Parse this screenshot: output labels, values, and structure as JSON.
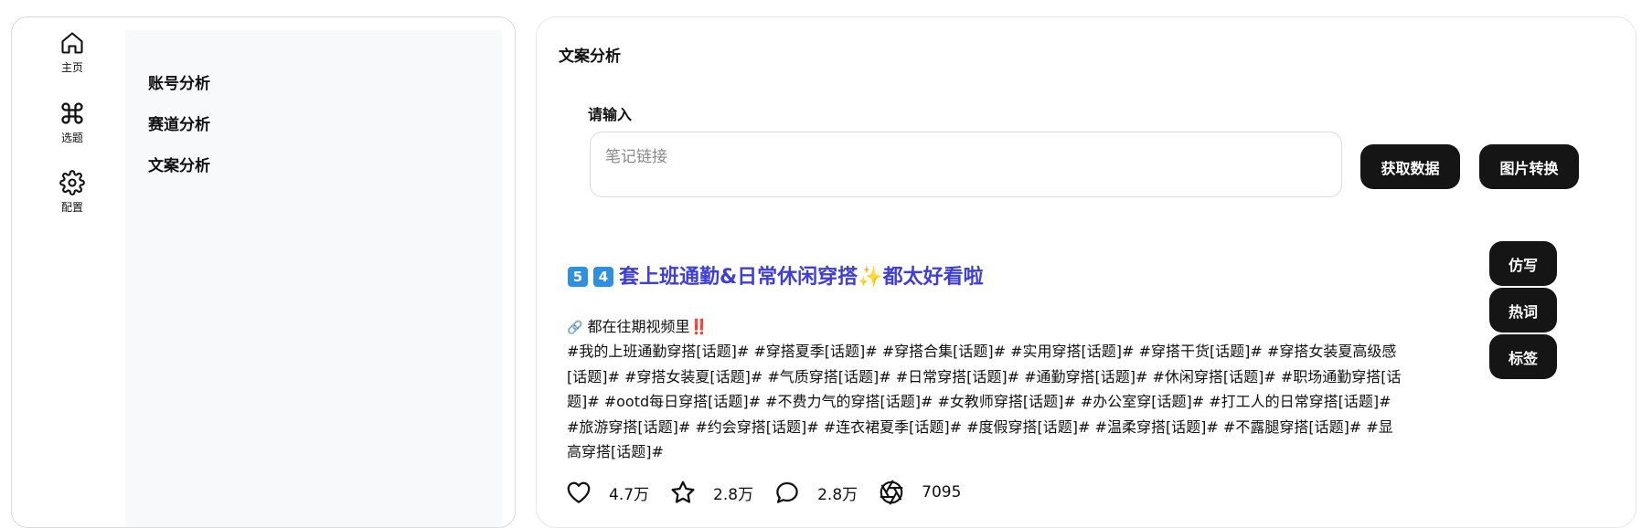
{
  "sidebar": {
    "rail": [
      {
        "label": "主页",
        "icon": "home-icon"
      },
      {
        "label": "选题",
        "icon": "command-icon"
      },
      {
        "label": "配置",
        "icon": "gear-icon"
      }
    ],
    "submenu": [
      "账号分析",
      "赛道分析",
      "文案分析"
    ]
  },
  "main": {
    "title": "文案分析",
    "input_label": "请输入",
    "input_placeholder": "笔记链接",
    "input_value": "",
    "fetch_button": "获取数据",
    "convert_button": "图片转换"
  },
  "note": {
    "num1": "5",
    "num2": "4",
    "title": "套上班通勤&日常休闲穿搭",
    "sparkle": "✨",
    "title_end": "都太好看啦",
    "link_icon": "🔗",
    "line1": "都在往期视频里",
    "bang": "‼️",
    "body": "#我的上班通勤穿搭[话题]# #穿搭夏季[话题]# #穿搭合集[话题]# #实用穿搭[话题]# #穿搭干货[话题]# #穿搭女装夏高级感[话题]# #穿搭女装夏[话题]# #气质穿搭[话题]# #日常穿搭[话题]# #通勤穿搭[话题]# #休闲穿搭[话题]# #职场通勤穿搭[话题]# #ootd每日穿搭[话题]# #不费力气的穿搭[话题]# #女教师穿搭[话题]# #办公室穿[话题]# #打工人的日常穿搭[话题]# #旅游穿搭[话题]# #约会穿搭[话题]# #连衣裙夏季[话题]# #度假穿搭[话题]# #温柔穿搭[话题]# #不露腿穿搭[话题]# #显高穿搭[话题]#",
    "actions": [
      "仿写",
      "热词",
      "标签"
    ],
    "stats": {
      "likes": "4.7万",
      "collects": "2.8万",
      "comments": "2.8万",
      "shares": "7095"
    }
  },
  "colors": {
    "button_bg": "#151515",
    "title_color": "#3f3fd6",
    "submenu_bg": "#f8f9fb"
  }
}
